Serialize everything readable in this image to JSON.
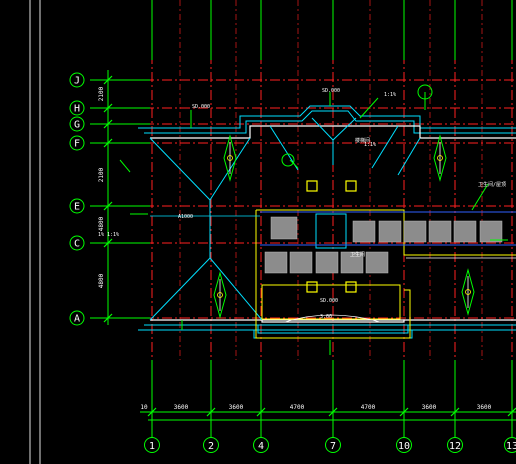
{
  "drawing": {
    "row_axes": [
      "J",
      "H",
      "G",
      "F",
      "E",
      "C",
      "A"
    ],
    "column_axes": [
      "1",
      "2",
      "4",
      "7",
      "10",
      "12",
      "13"
    ],
    "left_dimensions": [
      "2100",
      "2100",
      "4800",
      "4800"
    ],
    "bottom_dimensions": [
      "3600",
      "3600",
      "4700",
      "4700",
      "3600",
      "3600"
    ],
    "bottom_small_label": "10",
    "annotations": {
      "top_roof": "SD.000",
      "top_right": "1:1%",
      "roof_slope": "1:1%",
      "room_center": "卫生间",
      "mid_label": "A1000",
      "stair_label": "楼梯间",
      "bottom_label": "SD.000",
      "bottom_center": "3.00",
      "right_label": "卫生间/屋顶",
      "left_side": "1% 1:1%",
      "gutter_label": "SD.000"
    }
  },
  "colors": {
    "background": "#000000",
    "axis_green": "#00ff00",
    "grid_red": "#ff2020",
    "outline_white": "#ffffff",
    "cyan": "#00e0ff",
    "yellow": "#ffff00",
    "gray_blocks": "#8c8c8c",
    "blue_lines": "#3060ff"
  }
}
